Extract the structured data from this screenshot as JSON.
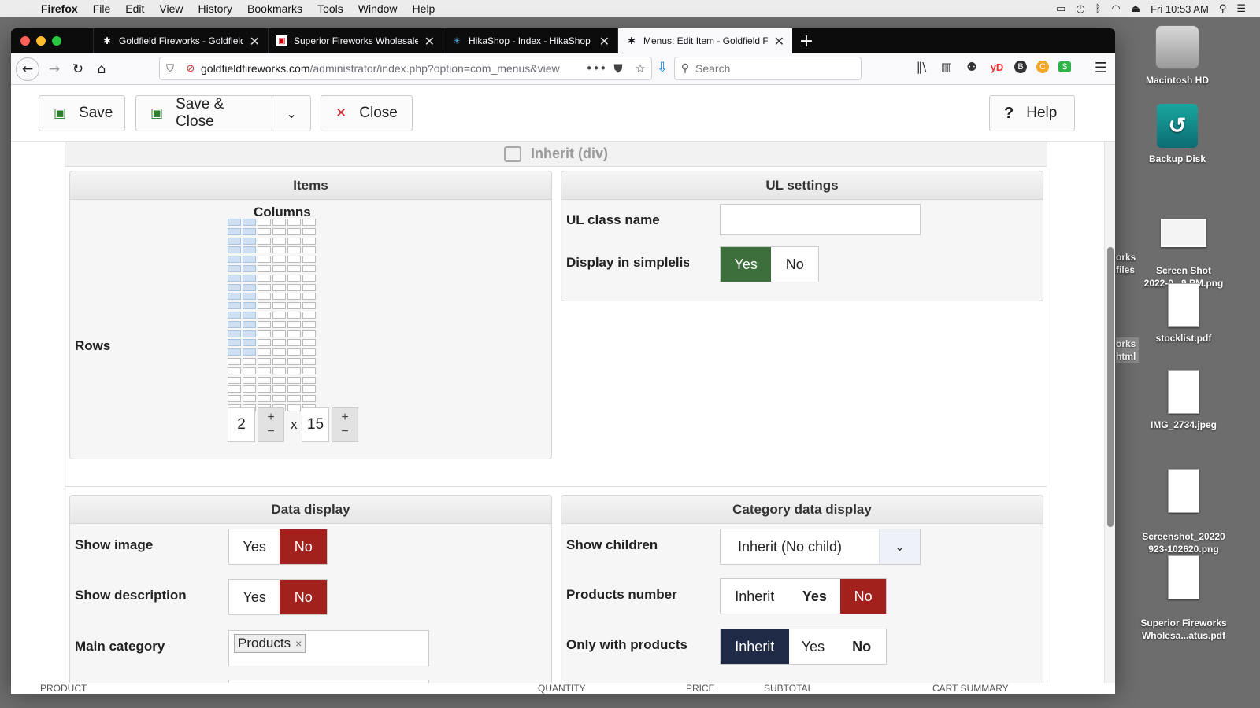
{
  "menubar": {
    "apple": "",
    "app": "Firefox",
    "items": [
      "File",
      "Edit",
      "View",
      "History",
      "Bookmarks",
      "Tools",
      "Window",
      "Help"
    ],
    "clock": "Fri 10:53 AM"
  },
  "desktop": {
    "items": [
      {
        "label": "Macintosh HD",
        "icon": "hard-drive-icon"
      },
      {
        "label": "Backup Disk",
        "icon": "time-machine-icon"
      },
      {
        "label": "Screen Shot\n2022-0...9 PM.png",
        "icon": "screenshot-file-icon"
      },
      {
        "label": "stocklist.pdf",
        "icon": "pdf-file-icon"
      },
      {
        "label": "IMG_2734.jpeg",
        "icon": "image-file-icon"
      },
      {
        "label": "Screenshot_20220\n923-102620.png",
        "icon": "screenshot-file-icon"
      },
      {
        "label": "Superior Fireworks\nWholesa...atus.pdf",
        "icon": "pdf-file-icon"
      }
    ],
    "partial_labels": [
      {
        "text": "orks\nfiles"
      },
      {
        "text": "orks\nhtml"
      }
    ]
  },
  "browser": {
    "tabs": [
      {
        "title": "Goldfield Fireworks - Goldfield,",
        "active": false
      },
      {
        "title": "Superior Fireworks Wholesale: (",
        "active": false
      },
      {
        "title": "HikaShop - Index - HikaShop",
        "active": false
      },
      {
        "title": "Menus: Edit Item - Goldfield Fir",
        "active": true
      }
    ],
    "url_host": "goldfieldfireworks.com",
    "url_path": "/administrator/index.php?option=com_menus&view",
    "search_placeholder": "Search"
  },
  "toolbar": {
    "save": "Save",
    "save_close": "Save & Close",
    "close": "Close",
    "help": "Help"
  },
  "layout_section": {
    "inherit_label": "Inherit (div)"
  },
  "items_box": {
    "title": "Items",
    "columns_label": "Columns",
    "rows_label": "Rows",
    "columns_value": "2",
    "x_label": "x",
    "rows_value": "15",
    "plus": "+",
    "minus": "−",
    "grid_columns": 6,
    "grid_rows": 21,
    "selected_columns": 2,
    "selected_rows": 15
  },
  "ul_settings": {
    "title": "UL settings",
    "class_label": "UL class name",
    "class_value": "",
    "simplelist_label": "Display in simplelist",
    "yes": "Yes",
    "no": "No",
    "simplelist_selected": "Yes"
  },
  "data_display": {
    "title": "Data display",
    "show_image_label": "Show image",
    "show_image_yes": "Yes",
    "show_image_no": "No",
    "show_image_selected": "No",
    "show_description_label": "Show description",
    "show_description_yes": "Yes",
    "show_description_no": "No",
    "show_description_selected": "No",
    "main_category_label": "Main category",
    "main_category_chip": "Products",
    "chip_remove": "×"
  },
  "category_display": {
    "title": "Category data display",
    "show_children_label": "Show children",
    "show_children_value": "Inherit (No child)",
    "products_number_label": "Products number",
    "pn_inherit": "Inherit",
    "pn_yes": "Yes",
    "pn_no": "No",
    "pn_selected": "No",
    "only_products_label": "Only with products",
    "op_inherit": "Inherit",
    "op_yes": "Yes",
    "op_no": "No",
    "op_selected": "Inherit"
  },
  "background_strip": {
    "cols": [
      "PRODUCT",
      "QUANTITY",
      "PRICE",
      "SUBTOTAL",
      "CART SUMMARY"
    ]
  },
  "colors": {
    "green_active": "#3d6f3d",
    "red_active": "#a3211d",
    "navy_active": "#1e2a46",
    "grid_selected": "#cfe0f2"
  }
}
